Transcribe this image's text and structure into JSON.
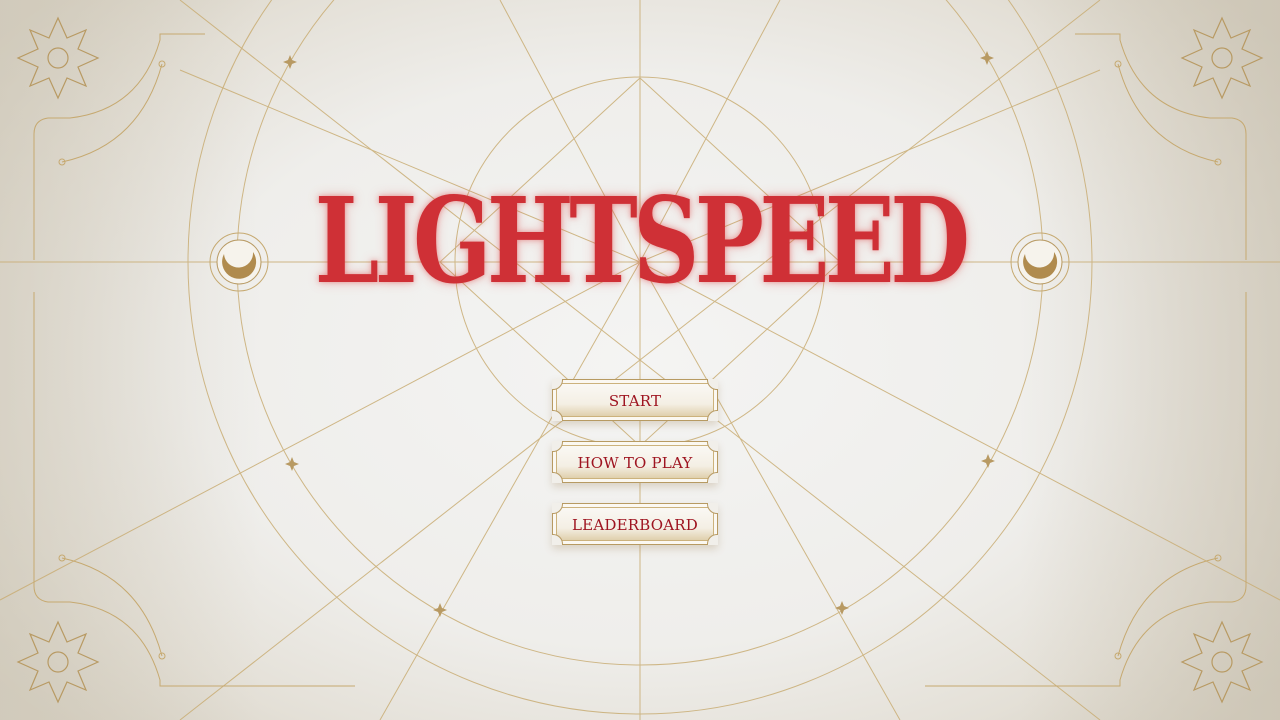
{
  "game": {
    "title": "LIGHTSPEED"
  },
  "menu": {
    "items": [
      {
        "label": "START"
      },
      {
        "label": "HOW TO PLAY"
      },
      {
        "label": "LEADERBOARD"
      }
    ]
  },
  "colors": {
    "title": "#cf3036",
    "button_text": "#9e1420",
    "ornament_gold": "#b89a63"
  },
  "icons": {
    "corner_ornament": "eight-point-star-icon",
    "side_ornament": "crescent-moon-icon",
    "node_ornament": "four-point-star-icon"
  }
}
